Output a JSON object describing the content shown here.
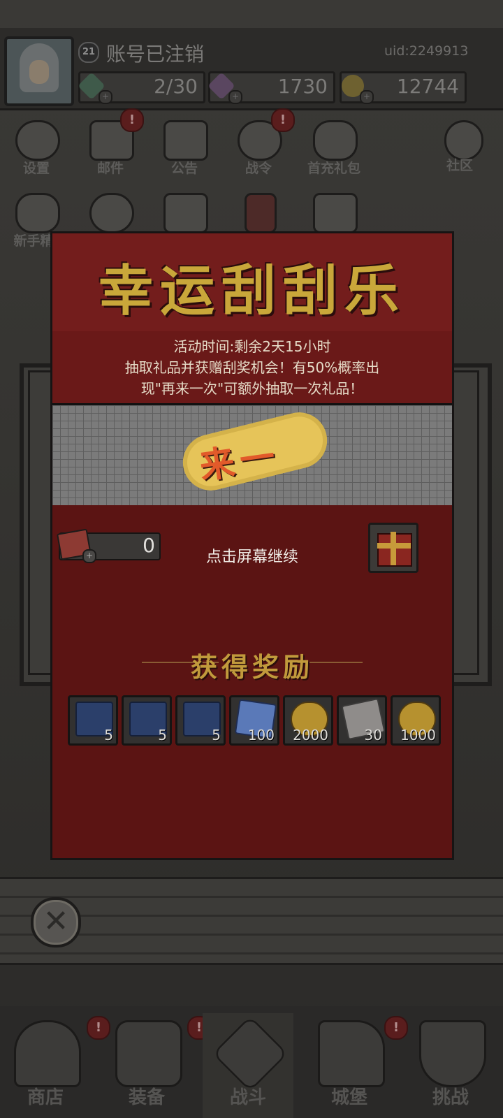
{
  "player": {
    "level": "21",
    "name": "账号已注销",
    "uid": "uid:2249913",
    "energy": "2/30",
    "gems": "1730",
    "gold": "12744"
  },
  "menu": {
    "row1": [
      {
        "label": "设置",
        "icon": "gear-icon"
      },
      {
        "label": "邮件",
        "icon": "mail-icon",
        "badge": "!"
      },
      {
        "label": "公告",
        "icon": "scroll-icon"
      },
      {
        "label": "战令",
        "icon": "crystal-ball-icon",
        "badge": "!"
      },
      {
        "label": "首充礼包",
        "icon": "money-bag-icon"
      },
      {
        "label": "社区",
        "icon": "home-icon"
      }
    ],
    "row2": [
      {
        "label": "新手精",
        "icon": "newbie-bag-icon"
      }
    ]
  },
  "nav": [
    {
      "label": "商店",
      "icon": "shop-icon",
      "badge": "!"
    },
    {
      "label": "装备",
      "icon": "armor-icon",
      "badge": "!"
    },
    {
      "label": "战斗",
      "icon": "crossed-swords-icon"
    },
    {
      "label": "城堡",
      "icon": "castle-icon",
      "badge": "!"
    },
    {
      "label": "挑战",
      "icon": "challenge-icon"
    }
  ],
  "modal": {
    "title": "幸运刮刮乐",
    "time_text": "活动时间:剩余2天15小时",
    "desc_line1": "抽取礼品并获赠刮奖机会！有50%概率出",
    "desc_line2": "现\"再来一次\"可额外抽取一次礼品！",
    "scratch_revealed": "来一",
    "ticket_count": "0",
    "tap_continue": "点击屏幕继续",
    "reward_title": "获得奖励",
    "rewards": [
      {
        "icon": "blue-book-icon",
        "count": "5"
      },
      {
        "icon": "blue-book-icon",
        "count": "5"
      },
      {
        "icon": "blue-book-icon",
        "count": "5"
      },
      {
        "icon": "blue-crystal-icon",
        "count": "100"
      },
      {
        "icon": "gold-coin-icon",
        "count": "2000"
      },
      {
        "icon": "silver-gem-icon",
        "count": "30"
      },
      {
        "icon": "gold-coin-icon",
        "count": "1000"
      }
    ]
  },
  "colors": {
    "modal_red": "#6a1918",
    "title_gold": "#c9a73a",
    "scratch_gray": "#7b7b7b",
    "prize_gold": "#e6c459"
  }
}
